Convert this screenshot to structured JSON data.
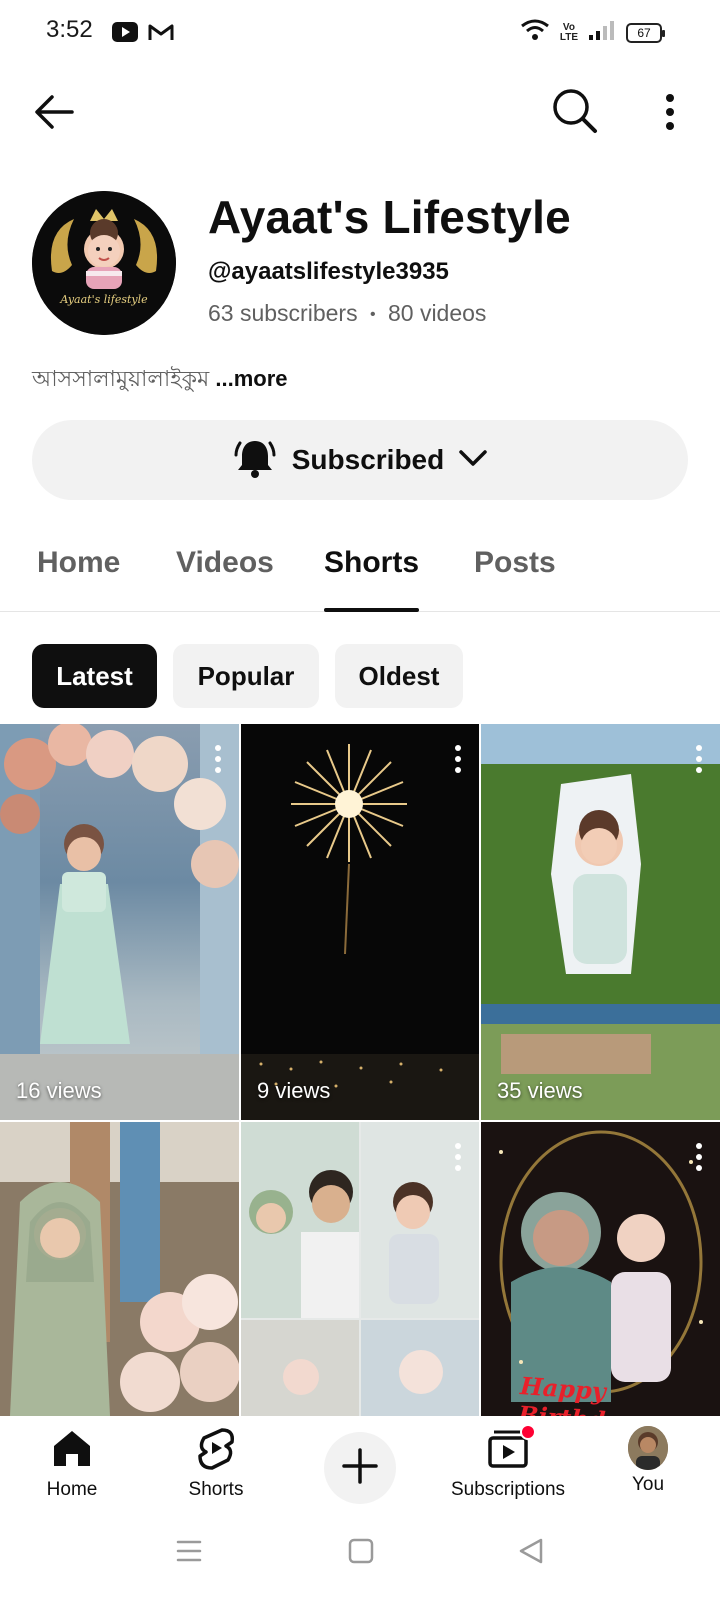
{
  "status_bar": {
    "time": "3:52",
    "battery": "67",
    "icons": [
      "youtube-icon",
      "gmail-icon",
      "wifi-icon",
      "volte-icon",
      "signal-icon",
      "battery-icon"
    ],
    "volte_top": "Vo",
    "volte_bottom": "LTE"
  },
  "app_bar": {
    "icons": [
      "back-arrow-icon",
      "search-icon",
      "more-vert-icon"
    ]
  },
  "channel": {
    "name": "Ayaat's Lifestyle",
    "handle": "@ayaatslifestyle3935",
    "subscribers": "63 subscribers",
    "separator": "•",
    "videos": "80 videos",
    "description": "আসসালামুয়ালাইকুম",
    "more_label": "...more",
    "avatar_caption": "Ayaat's lifestyle"
  },
  "subscribe_button": {
    "label": "Subscribed",
    "icons": [
      "bell-icon",
      "chevron-down-icon"
    ]
  },
  "tabs": [
    {
      "label": "Home",
      "active": false
    },
    {
      "label": "Videos",
      "active": false
    },
    {
      "label": "Shorts",
      "active": true
    },
    {
      "label": "Posts",
      "active": false
    }
  ],
  "chips": [
    {
      "label": "Latest",
      "active": true
    },
    {
      "label": "Popular",
      "active": false
    },
    {
      "label": "Oldest",
      "active": false
    }
  ],
  "shorts": [
    {
      "views": "16 views",
      "scene": "girl in mint dress under flower arch"
    },
    {
      "views": "9 views",
      "scene": "firework over city at night"
    },
    {
      "views": "35 views",
      "scene": "baby framed in hedge wall"
    },
    {
      "views": "",
      "scene": "woman in hijab with flowers"
    },
    {
      "views": "",
      "scene": "family collage"
    },
    {
      "views": "",
      "scene": "Happy Birthday portrait",
      "overlay_text": "Happy Birthday"
    }
  ],
  "bottom_nav": [
    {
      "label": "Home",
      "icon": "home-icon"
    },
    {
      "label": "Shorts",
      "icon": "shorts-icon"
    },
    {
      "label": "",
      "icon": "plus-icon"
    },
    {
      "label": "Subscriptions",
      "icon": "subscriptions-icon"
    },
    {
      "label": "You",
      "icon": "avatar-icon"
    }
  ],
  "system_nav": {
    "icons": [
      "menu-icon",
      "home-square-icon",
      "back-triangle-icon"
    ]
  },
  "colors": {
    "text_primary": "#0f0f0f",
    "text_secondary": "#606060",
    "chip_bg": "#f2f2f2",
    "notification_dot": "#ff0033"
  }
}
